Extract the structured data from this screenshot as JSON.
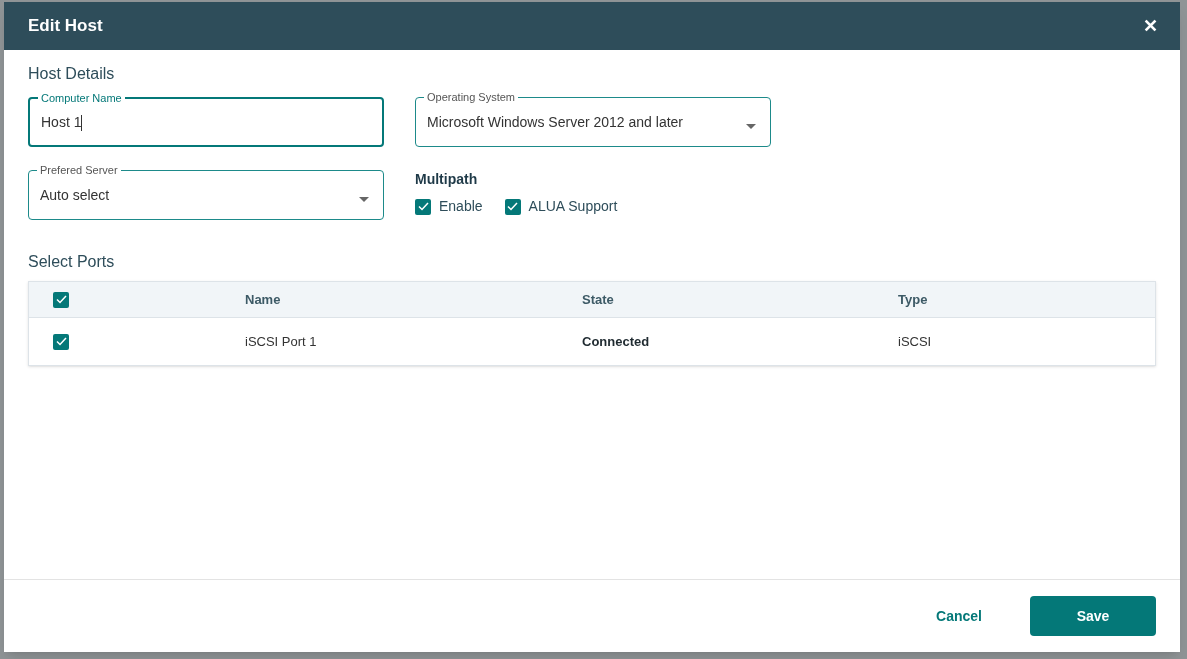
{
  "dialog": {
    "title": "Edit Host",
    "close": "✕"
  },
  "host_details": {
    "heading": "Host Details",
    "computer_name": {
      "label": "Computer Name",
      "value": "Host 1",
      "focused": true
    },
    "operating_system": {
      "label": "Operating System",
      "value": "Microsoft Windows Server 2012 and later",
      "focused": false
    },
    "preferred_server": {
      "label": "Prefered Server",
      "value": "Auto select",
      "focused": false
    },
    "multipath": {
      "heading": "Multipath",
      "options": [
        {
          "label": "Enable",
          "checked": true
        },
        {
          "label": "ALUA Support",
          "checked": true
        }
      ]
    }
  },
  "ports": {
    "heading": "Select Ports",
    "all_checked": true,
    "columns": [
      "Name",
      "State",
      "Type"
    ],
    "rows": [
      {
        "checked": true,
        "name": "iSCSI Port 1",
        "state": "Connected",
        "type": "iSCSI"
      }
    ]
  },
  "buttons": {
    "cancel": "Cancel",
    "save": "Save"
  }
}
